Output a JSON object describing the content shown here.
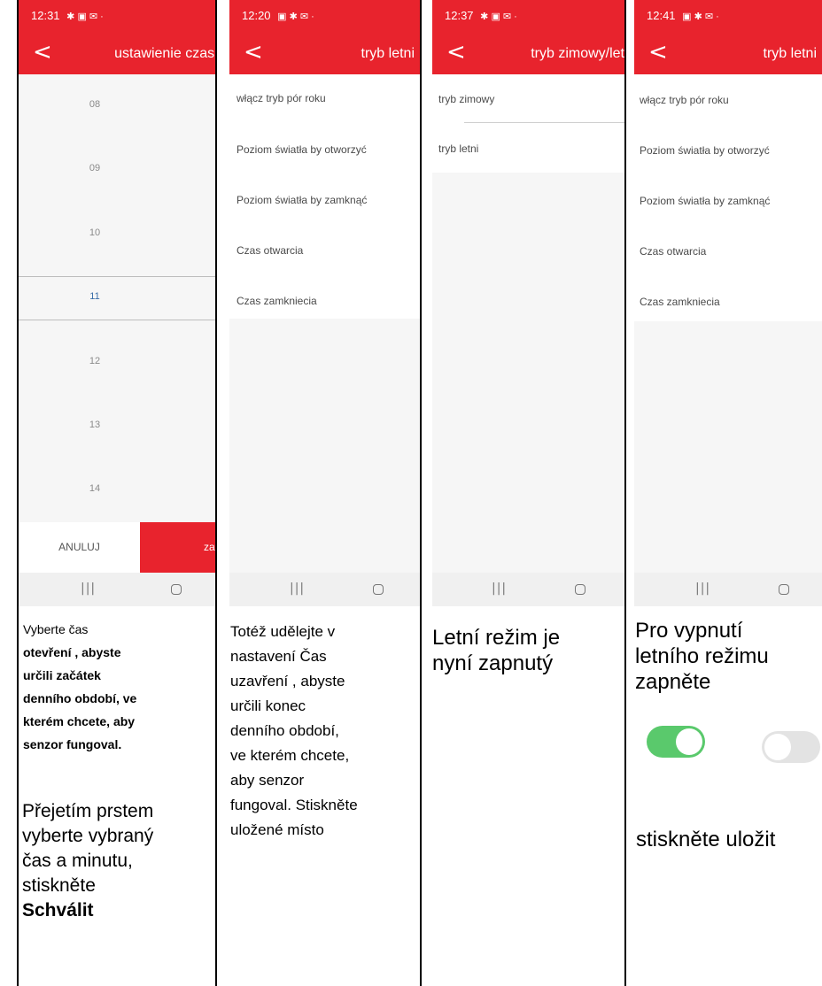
{
  "panels": [
    {
      "time": "12:31",
      "status_icons": "✱ ▣ ✉ ·",
      "title": "ustawienie czasu",
      "picker": [
        "08",
        "09",
        "10",
        "11",
        "12",
        "13",
        "14"
      ],
      "selected": "11",
      "cancel_label": "ANULUJ",
      "ok_label": "zat",
      "caption_lines": [
        "Vyberte čas"
      ],
      "caption_bold_lines": [
        "otevření , abyste",
        "určili začátek",
        "denního období, ve",
        "kterém chcete, aby",
        "senzor fungoval."
      ],
      "caption2_lines": [
        "Přejetím prstem",
        "vyberte vybraný",
        "čas a minutu,",
        "stiskněte"
      ],
      "caption2_bold": "Schválit"
    },
    {
      "time": "12:20",
      "status_icons": "▣ ✱ ✉ ·",
      "title": "tryb letni",
      "menu": [
        "włącz tryb pór roku",
        "Poziom światła by otworzyć",
        "Poziom światła by zamknąć",
        "Czas otwarcia",
        "Czas zamkniecia"
      ],
      "caption_lines": [
        "Totéž udělejte v",
        "nastavení Čas",
        "uzavření , abyste",
        "určili konec",
        "denního období,",
        "ve kterém chcete,",
        "aby senzor",
        "fungoval. Stiskněte",
        "uložené místo"
      ]
    },
    {
      "time": "12:37",
      "status_icons": "✱ ▣ ✉ ·",
      "title": "tryb zimowy/let",
      "menu": [
        "tryb zimowy",
        "tryb letni"
      ],
      "caption_lines": [
        "Letní režim je",
        "nyní zapnutý"
      ]
    },
    {
      "time": "12:41",
      "status_icons": "▣ ✱ ✉ ·",
      "title": "tryb letni",
      "menu": [
        "włącz tryb pór roku",
        "Poziom światła by otworzyć",
        "Poziom światła by zamknąć",
        "Czas otwarcia",
        "Czas zamkniecia"
      ],
      "caption_lines": [
        "Pro vypnutí",
        "letního režimu",
        "zapněte"
      ],
      "toggle_states": [
        "on",
        "off"
      ],
      "caption2": "stiskněte uložit"
    }
  ],
  "nav": {
    "recent_glyph": "|||",
    "back_glyph": "<"
  },
  "colors": {
    "accent": "#e8232d",
    "toggle_on": "#5ac96c",
    "toggle_off": "#e3e3e3",
    "selected_text": "#3a6ea8"
  }
}
